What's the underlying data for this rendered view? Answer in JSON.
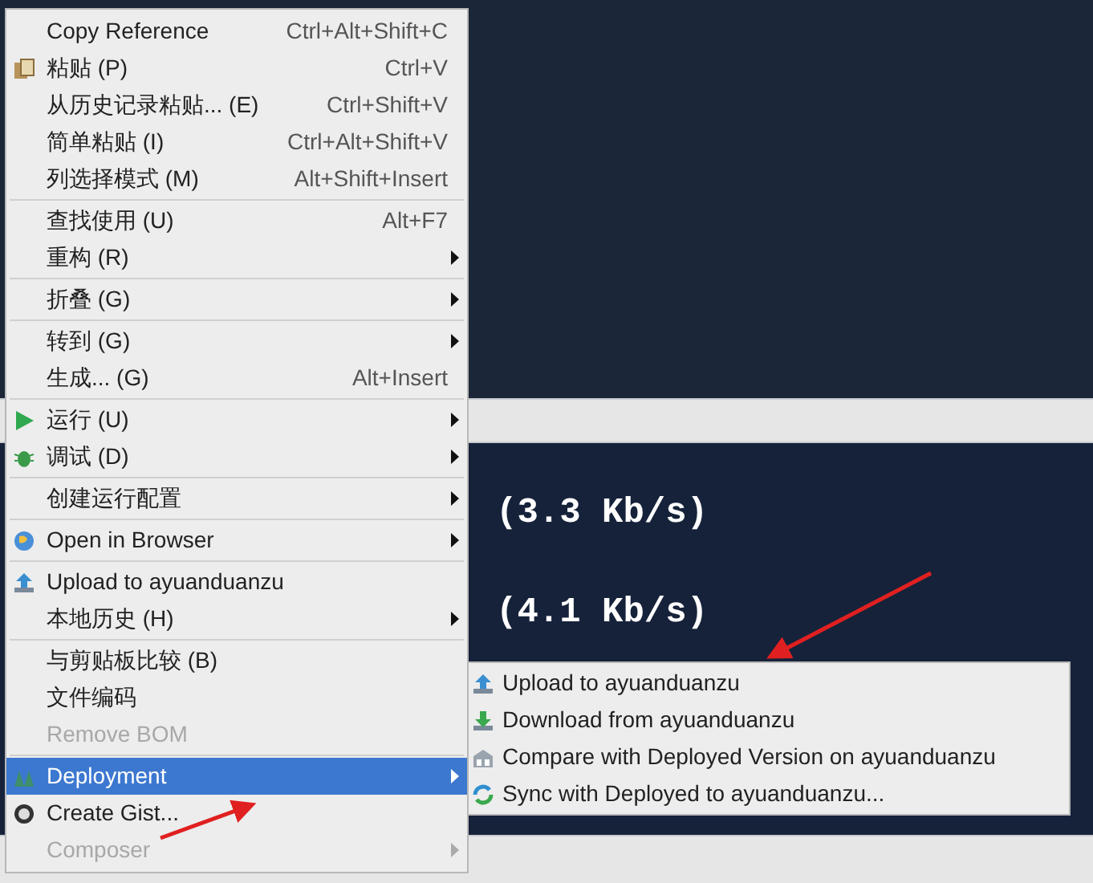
{
  "terminal": {
    "lines": [
      "(3.3 Kb/s)",
      "(4.1 Kb/s)"
    ]
  },
  "context_menu": {
    "items": [
      {
        "kind": "item",
        "label": "Copy Reference",
        "shortcut": "Ctrl+Alt+Shift+C",
        "submenu": false,
        "disabled": false,
        "selected": false
      },
      {
        "kind": "item",
        "label": "粘贴 (P)",
        "shortcut": "Ctrl+V",
        "submenu": false,
        "disabled": false,
        "selected": false
      },
      {
        "kind": "item",
        "label": "从历史记录粘贴... (E)",
        "shortcut": "Ctrl+Shift+V",
        "submenu": false,
        "disabled": false,
        "selected": false
      },
      {
        "kind": "item",
        "label": "简单粘贴 (I)",
        "shortcut": "Ctrl+Alt+Shift+V",
        "submenu": false,
        "disabled": false,
        "selected": false
      },
      {
        "kind": "item",
        "label": "列选择模式 (M)",
        "shortcut": "Alt+Shift+Insert",
        "submenu": false,
        "disabled": false,
        "selected": false
      },
      {
        "kind": "separator"
      },
      {
        "kind": "item",
        "label": "查找使用 (U)",
        "shortcut": "Alt+F7",
        "submenu": false,
        "disabled": false,
        "selected": false
      },
      {
        "kind": "item",
        "label": "重构 (R)",
        "submenu": true,
        "disabled": false,
        "selected": false
      },
      {
        "kind": "separator"
      },
      {
        "kind": "item",
        "label": "折叠 (G)",
        "submenu": true,
        "disabled": false,
        "selected": false
      },
      {
        "kind": "separator"
      },
      {
        "kind": "item",
        "label": "转到 (G)",
        "submenu": true,
        "disabled": false,
        "selected": false
      },
      {
        "kind": "item",
        "label": "生成... (G)",
        "shortcut": "Alt+Insert",
        "submenu": false,
        "disabled": false,
        "selected": false
      },
      {
        "kind": "separator"
      },
      {
        "kind": "item",
        "label": "运行 (U)",
        "submenu": true,
        "disabled": false,
        "selected": false
      },
      {
        "kind": "item",
        "label": "调试 (D)",
        "submenu": true,
        "disabled": false,
        "selected": false
      },
      {
        "kind": "separator"
      },
      {
        "kind": "item",
        "label": "创建运行配置",
        "submenu": true,
        "disabled": false,
        "selected": false
      },
      {
        "kind": "separator"
      },
      {
        "kind": "item",
        "label": "Open in Browser",
        "submenu": true,
        "disabled": false,
        "selected": false
      },
      {
        "kind": "separator"
      },
      {
        "kind": "item",
        "label": "Upload to ayuanduanzu",
        "submenu": false,
        "disabled": false,
        "selected": false
      },
      {
        "kind": "item",
        "label": "本地历史 (H)",
        "submenu": true,
        "disabled": false,
        "selected": false
      },
      {
        "kind": "separator"
      },
      {
        "kind": "item",
        "label": "与剪贴板比较 (B)",
        "submenu": false,
        "disabled": false,
        "selected": false
      },
      {
        "kind": "item",
        "label": "文件编码",
        "submenu": false,
        "disabled": false,
        "selected": false
      },
      {
        "kind": "item",
        "label": "Remove BOM",
        "submenu": false,
        "disabled": true,
        "selected": false
      },
      {
        "kind": "separator"
      },
      {
        "kind": "item",
        "label": "Deployment",
        "submenu": true,
        "disabled": false,
        "selected": true
      },
      {
        "kind": "item",
        "label": "Create Gist...",
        "submenu": false,
        "disabled": false,
        "selected": false
      },
      {
        "kind": "item",
        "label": "Composer",
        "submenu": true,
        "disabled": true,
        "selected": false
      }
    ]
  },
  "submenu": {
    "items": [
      {
        "label": "Upload to ayuanduanzu"
      },
      {
        "label": "Download from ayuanduanzu"
      },
      {
        "label": "Compare with Deployed Version on ayuanduanzu"
      },
      {
        "label": "Sync with Deployed to ayuanduanzu..."
      }
    ]
  }
}
